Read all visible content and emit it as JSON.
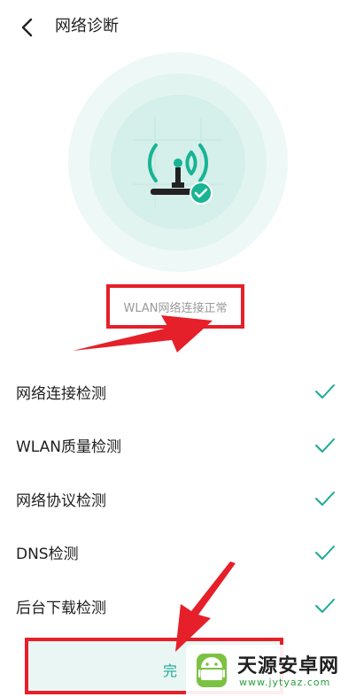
{
  "header": {
    "title": "网络诊断",
    "back_icon": "chevron-left-icon"
  },
  "status": {
    "text": "WLAN网络连接正常"
  },
  "checks": [
    {
      "label": "网络连接检测",
      "state": "passed"
    },
    {
      "label": "WLAN质量检测",
      "state": "passed"
    },
    {
      "label": "网络协议检测",
      "state": "passed"
    },
    {
      "label": "DNS检测",
      "state": "passed"
    },
    {
      "label": "后台下载检测",
      "state": "passed"
    }
  ],
  "done_button": {
    "label": "完"
  },
  "watermark": {
    "name": "天源安卓网",
    "url": "www.jytyaz.com"
  },
  "colors": {
    "accent": "#1aaa92",
    "annotation_red": "#e5202a"
  }
}
